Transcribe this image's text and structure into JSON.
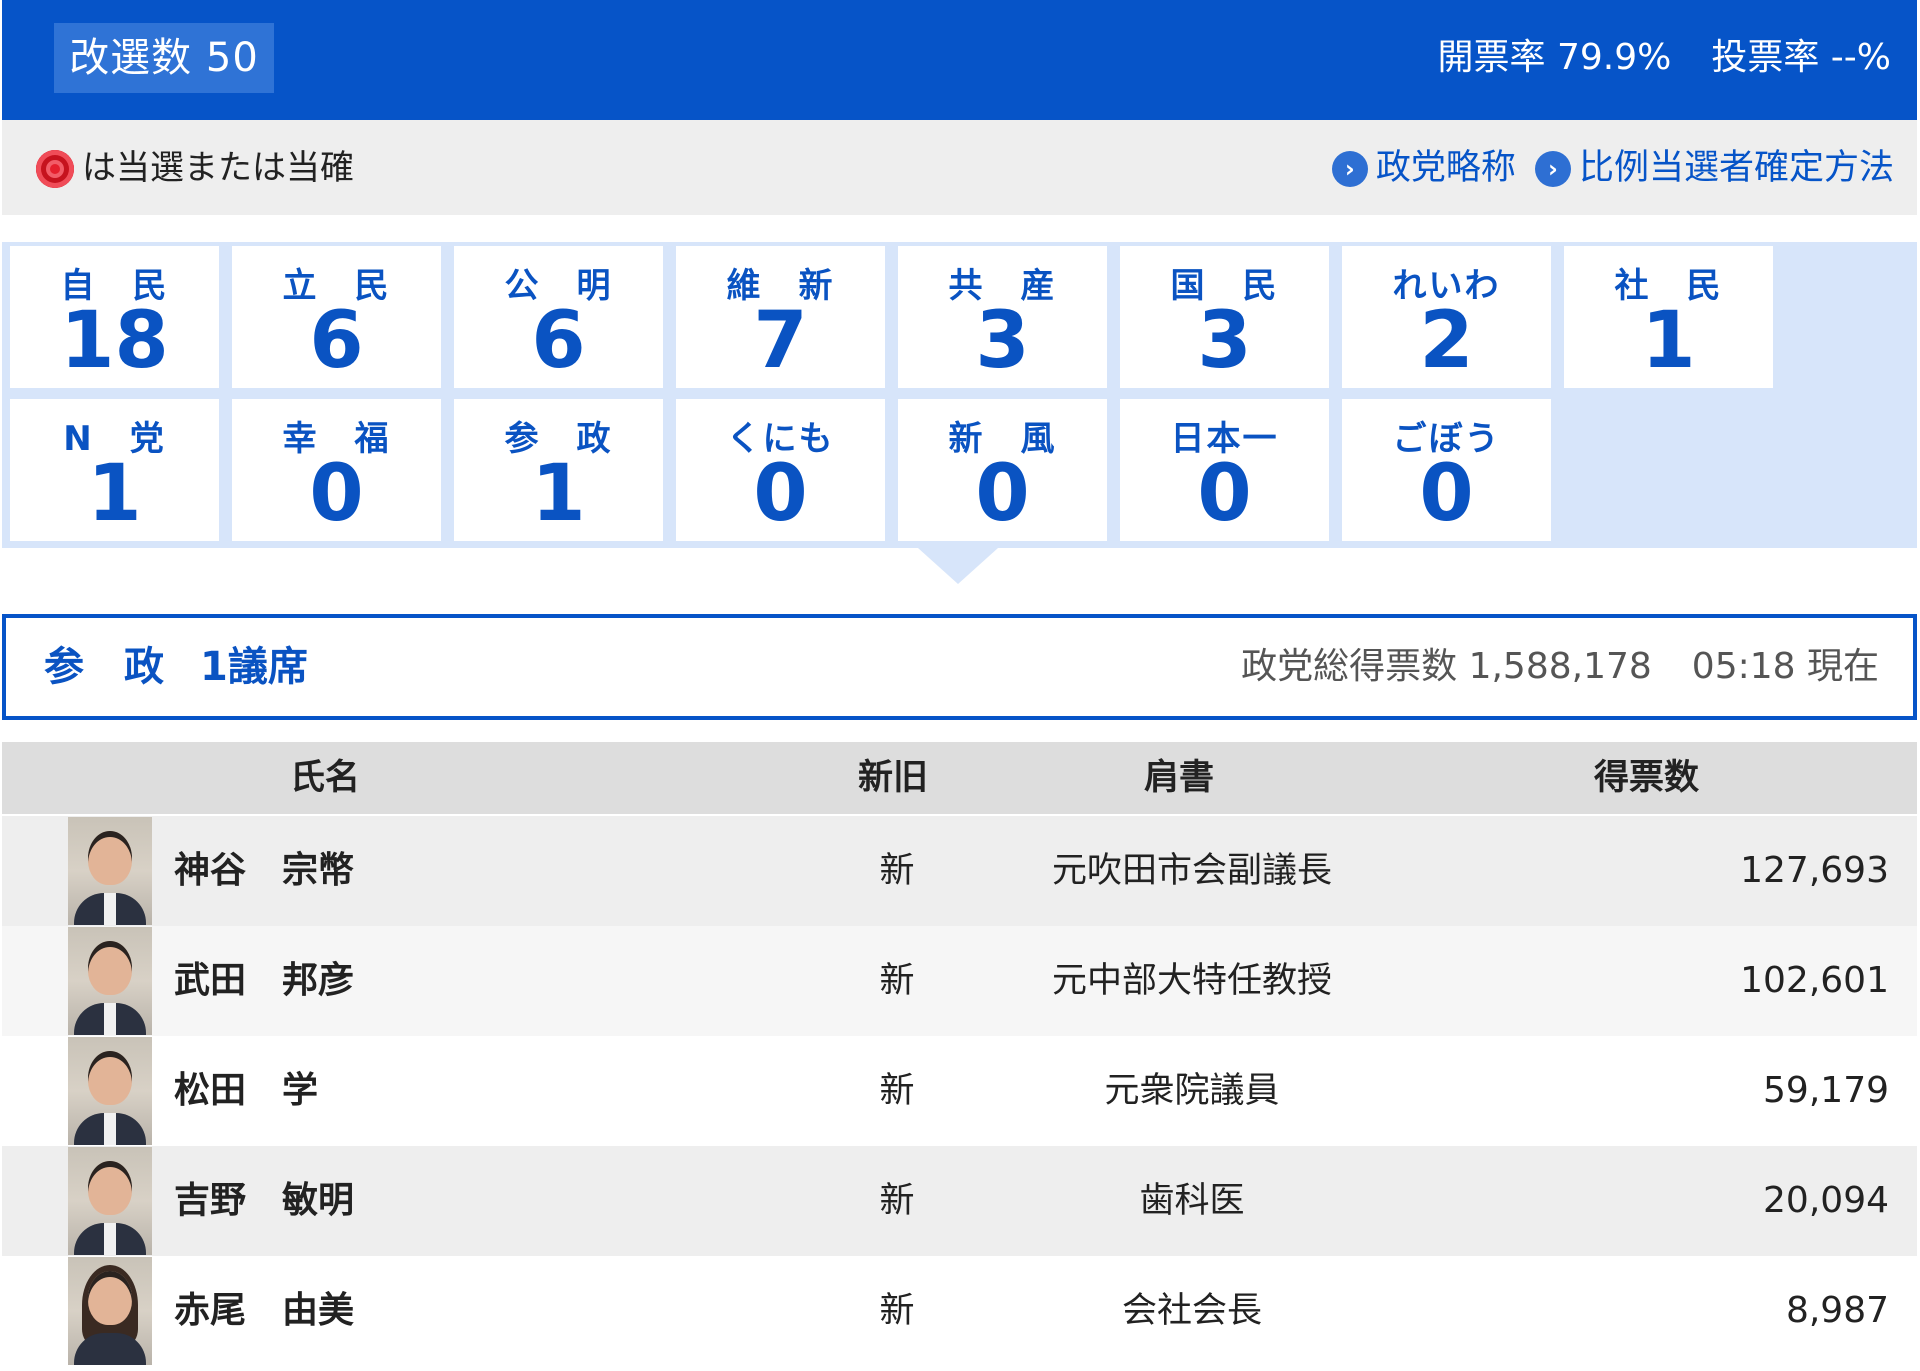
{
  "header": {
    "seats_label": "改選数 50",
    "counting_rate": "開票率 79.9%",
    "turnout_rate": "投票率 --%"
  },
  "legend": {
    "icon": "rose-winner-icon",
    "text": "は当選または当確",
    "links": [
      "政党略称",
      "比例当選者確定方法"
    ]
  },
  "parties": [
    {
      "name": "自　民",
      "seats": "18"
    },
    {
      "name": "立　民",
      "seats": "6"
    },
    {
      "name": "公　明",
      "seats": "6"
    },
    {
      "name": "維　新",
      "seats": "7"
    },
    {
      "name": "共　産",
      "seats": "3"
    },
    {
      "name": "国　民",
      "seats": "3"
    },
    {
      "name": "れいわ",
      "seats": "2"
    },
    {
      "name": "社　民",
      "seats": "1"
    },
    {
      "name": "N　党",
      "seats": "1"
    },
    {
      "name": "幸　福",
      "seats": "0"
    },
    {
      "name": "参　政",
      "seats": "1"
    },
    {
      "name": "くにも",
      "seats": "0"
    },
    {
      "name": "新　風",
      "seats": "0"
    },
    {
      "name": "日本一",
      "seats": "0"
    },
    {
      "name": "ごぼう",
      "seats": "0"
    }
  ],
  "selected": {
    "party": "参　政",
    "seats": "1議席",
    "total_votes": "政党総得票数 1,588,178",
    "time": "05:18 現在"
  },
  "table": {
    "headers": {
      "name": "氏名",
      "status": "新旧",
      "title": "肩書",
      "votes": "得票数"
    },
    "rows": [
      {
        "name": "神谷　宗幣",
        "status": "新",
        "title": "元吹田市会副議長",
        "votes": "127,693"
      },
      {
        "name": "武田　邦彦",
        "status": "新",
        "title": "元中部大特任教授",
        "votes": "102,601"
      },
      {
        "name": "松田　学",
        "status": "新",
        "title": "元衆院議員",
        "votes": "59,179"
      },
      {
        "name": "吉野　敏明",
        "status": "新",
        "title": "歯科医",
        "votes": "20,094"
      },
      {
        "name": "赤尾　由美",
        "status": "新",
        "title": "会社会長",
        "votes": "8,987"
      }
    ]
  },
  "colors": {
    "brand_blue": "#0654c8",
    "party_blue": "#0a53c2",
    "grid_bg": "#d7e5fa"
  }
}
